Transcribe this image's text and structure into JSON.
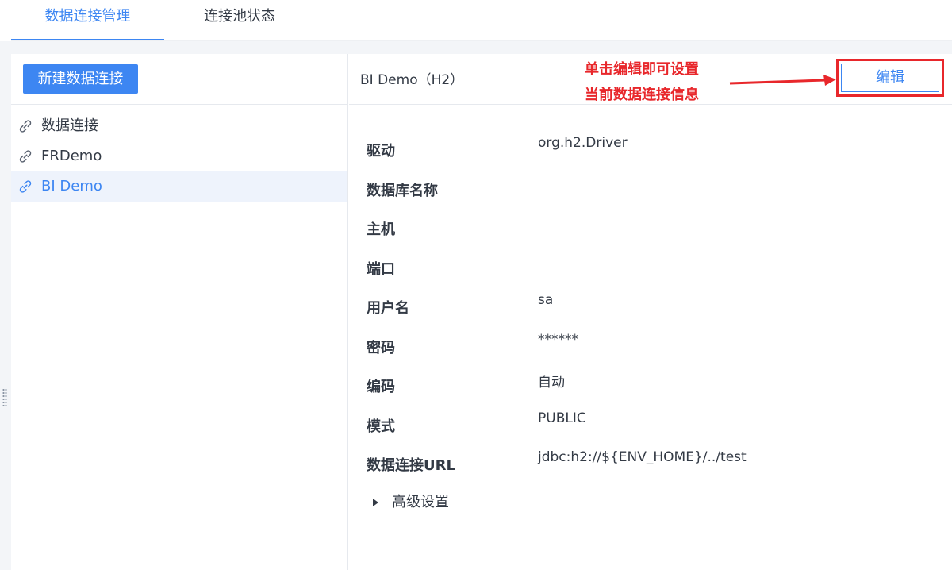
{
  "tabs": [
    {
      "label": "数据连接管理",
      "active": true
    },
    {
      "label": "连接池状态",
      "active": false
    }
  ],
  "sidebar": {
    "new_button_label": "新建数据连接",
    "items": [
      {
        "label": "数据连接",
        "icon": "link-icon",
        "active": false
      },
      {
        "label": "FRDemo",
        "icon": "link-icon",
        "active": false
      },
      {
        "label": "BI Demo",
        "icon": "link-icon",
        "active": true
      }
    ]
  },
  "detail": {
    "title": "BI Demo（H2）",
    "edit_label": "编辑",
    "annotation": {
      "line1": "单击编辑即可设置",
      "line2": "当前数据连接信息"
    },
    "fields": [
      {
        "label": "驱动",
        "value": "org.h2.Driver"
      },
      {
        "label": "数据库名称",
        "value": ""
      },
      {
        "label": "主机",
        "value": ""
      },
      {
        "label": "端口",
        "value": ""
      },
      {
        "label": "用户名",
        "value": "sa"
      },
      {
        "label": "密码",
        "value": "******"
      },
      {
        "label": "编码",
        "value": "自动"
      },
      {
        "label": "模式",
        "value": "PUBLIC"
      },
      {
        "label": "数据连接URL",
        "value": "jdbc:h2://${ENV_HOME}/../test"
      }
    ],
    "advanced_label": "高级设置"
  },
  "colors": {
    "accent": "#3d86f2",
    "annotation": "#e8272b",
    "background": "#f3f5f8",
    "active_item_bg": "#eef3fc"
  }
}
